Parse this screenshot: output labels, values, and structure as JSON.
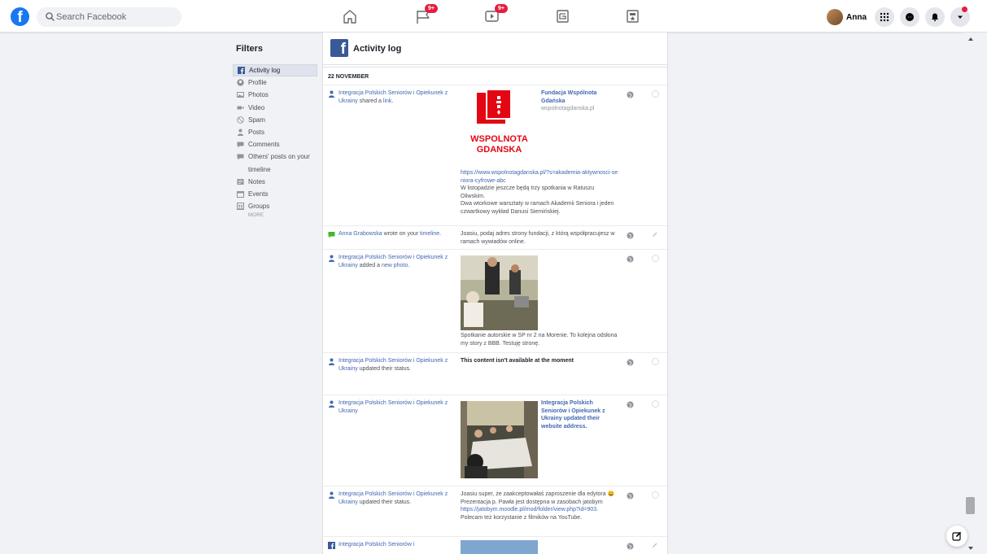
{
  "topbar": {
    "logo_letter": "f",
    "search_placeholder": "Search Facebook",
    "badge_pages": "9+",
    "badge_watch": "9+",
    "profile_name": "Anna"
  },
  "filters": {
    "title": "Filters",
    "items": [
      {
        "label": "Activity log",
        "icon": "facebook-square-icon"
      },
      {
        "label": "Profile",
        "icon": "profile-icon"
      },
      {
        "label": "Photos",
        "icon": "photos-icon"
      },
      {
        "label": "Video",
        "icon": "video-icon"
      },
      {
        "label": "Spam",
        "icon": "spam-icon"
      },
      {
        "label": "Posts",
        "icon": "posts-icon"
      },
      {
        "label": "Comments",
        "icon": "comments-icon"
      },
      {
        "label": "Others' posts on your",
        "icon": "others-posts-icon"
      },
      {
        "label": "timeline",
        "icon": ""
      },
      {
        "label": "Notes",
        "icon": "notes-icon"
      },
      {
        "label": "Events",
        "icon": "events-icon"
      },
      {
        "label": "Groups",
        "icon": "groups-icon"
      }
    ],
    "more": "MORE"
  },
  "main": {
    "header_letter": "f",
    "header_title": "Activity log",
    "date": "22 NOVEMBER",
    "entries": [
      {
        "actor": "Integracja Polskich Seniorów i Opiekunek z Ukrainy",
        "action": "shared a",
        "object": "link",
        "logo_line1": "WSPOLNOTA",
        "logo_line2": "GDANSKA",
        "site_title": "Fundacja Wspólnota Gdańska",
        "site_domain": "wspolnotagdanska.pl",
        "url": "https://www.wspolnotagdanska.pl/?s=akademia-aktywnosci-seniora-cyfrowe-abc",
        "text1": "W listopadzie jeszcze będą trzy spotkania w Ratuszu Oliwskim.",
        "text2": "Dwa wtorkowe warsztaty w ramach Akademii Seniora i jeden czwartkowy wykład Danusi Siemińskiej."
      },
      {
        "actor": "Anna Grabowska",
        "action": "wrote on your",
        "object": "timeline",
        "text": "Joasiu, podaj adres strony fundacji, z którą współpracujesz w ramach wywiadów online."
      },
      {
        "actor": "Integracja Polskich Seniorów i Opiekunek z Ukrainy",
        "action": "added a",
        "object": "new photo",
        "text": "Spotkanie autorskie w SP nr 2 na Morenie. To kolejna odsłona my story z BBB. Testuję stronę."
      },
      {
        "actor": "Integracja Polskich Seniorów i Opiekunek z Ukrainy",
        "action": "updated their status.",
        "text": "This content isn't available at the moment"
      },
      {
        "actor": "Integracja Polskich Seniorów i Opiekunek z Ukrainy",
        "side_text": "Integracja Polskich Seniorów i Opiekunek z Ukrainy updated their website address."
      },
      {
        "actor": "Integracja Polskich Seniorów i Opiekunek z Ukrainy",
        "action": "updated their status.",
        "text1": "Joasiu super, że zaakceptowałaś zaproszenie dla edytora",
        "emoji": "😀",
        "text2": "Prezentacja p. Pawła jest dostępna w zasobach jatobym",
        "link": "https://jatobym.moodle.pl/mod/folder/view.php?id=903.",
        "text3": "Polecam też korzystanie z filmików na YouTube."
      },
      {
        "actor": "Integracja Polskich Seniorów i"
      }
    ]
  },
  "colors": {
    "fb_blue": "#1877f2",
    "link_blue": "#4267b2",
    "badge_red": "#e41e3f",
    "logo_red": "#e30613"
  }
}
